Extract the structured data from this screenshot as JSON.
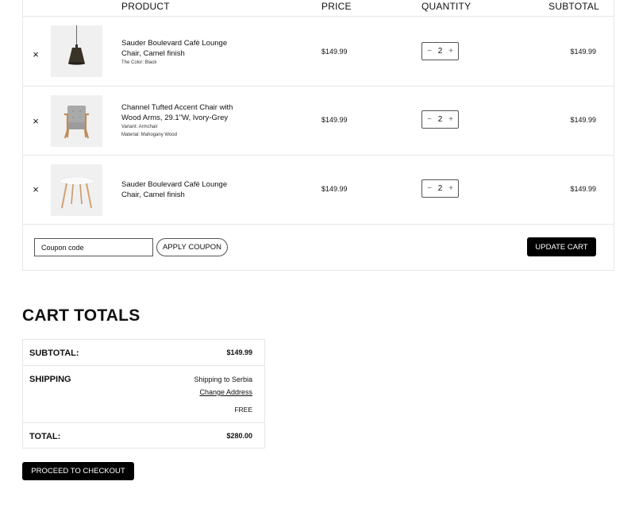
{
  "table": {
    "headers": {
      "product": "PRODUCT",
      "price": "PRICE",
      "quantity": "QUANTITY",
      "subtotal": "SUBTOTAL"
    },
    "items": [
      {
        "remove_icon": "×",
        "name": "Sauder Boulevard Café Lounge Chair, Camel finish",
        "meta": [
          "The Color: Black"
        ],
        "price": "$149.99",
        "quantity": "2",
        "subtotal": "$149.99",
        "image_icon": "pendant-lamp-image"
      },
      {
        "remove_icon": "×",
        "name": "Channel Tufted Accent Chair with Wood Arms, 29.1\"W, Ivory-Grey",
        "meta": [
          "Variant: Armchair",
          "Material: Mahogany Wood"
        ],
        "price": "$149.99",
        "quantity": "2",
        "subtotal": "$149.99",
        "image_icon": "armchair-image"
      },
      {
        "remove_icon": "×",
        "name": "Sauder Boulevard Café Lounge Chair, Camel finish",
        "meta": [],
        "price": "$149.99",
        "quantity": "2",
        "subtotal": "$149.99",
        "image_icon": "round-table-image"
      }
    ],
    "qty_minus": "−",
    "qty_plus": "+"
  },
  "coupon": {
    "placeholder": "Coupon code",
    "apply_label": "APPLY COUPON"
  },
  "update_label": "UPDATE CART",
  "totals": {
    "title": "CART TOTALS",
    "subtotal_label": "SUBTOTAL:",
    "subtotal_value": "$149.99",
    "shipping_label": "SHIPPING",
    "shipping_to": "Shipping to Serbia",
    "change_address": "Change Address",
    "shipping_cost": "FREE",
    "total_label": "TOTAL:",
    "total_value": "$280.00"
  },
  "checkout_label": "PROCEED TO CHECKOUT",
  "colors": {
    "button_bg": "#000000",
    "border": "#e6e6e6",
    "thumb_bg": "#f0f0f0"
  }
}
